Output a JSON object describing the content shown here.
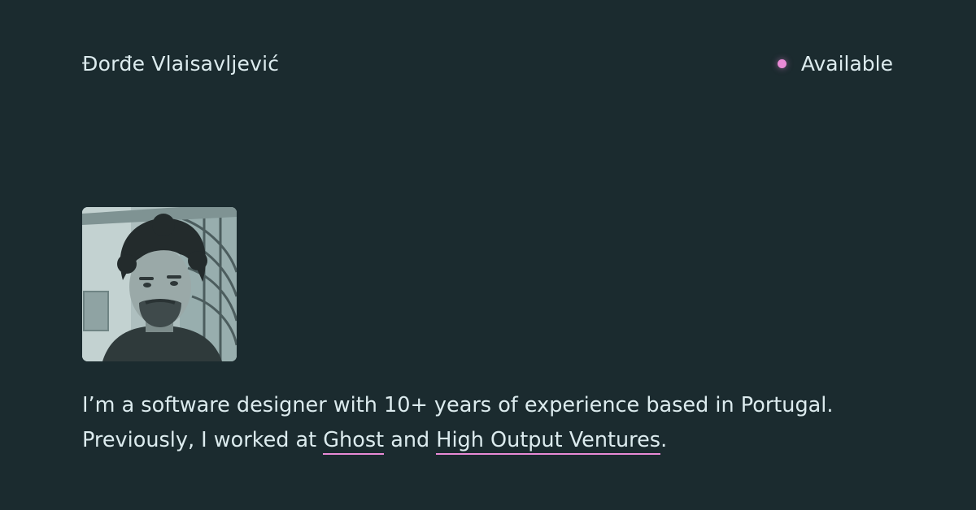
{
  "header": {
    "name": "Đorđe Vlaisavljević",
    "status_label": "Available",
    "status_color": "#e98ad6",
    "status_icon": "status-dot-icon"
  },
  "profile_photo": {
    "alt": "Portrait photo"
  },
  "bio": {
    "text_before": "I’m a software designer with 10+ years of experience based in Portugal. Previously, I worked at ",
    "link_1": "Ghost",
    "text_between": " and ",
    "link_2": "High Output Ventures",
    "text_after": "."
  },
  "colors": {
    "background": "#1b2b2f",
    "text": "#dcebee",
    "accent": "#e98ad6"
  }
}
